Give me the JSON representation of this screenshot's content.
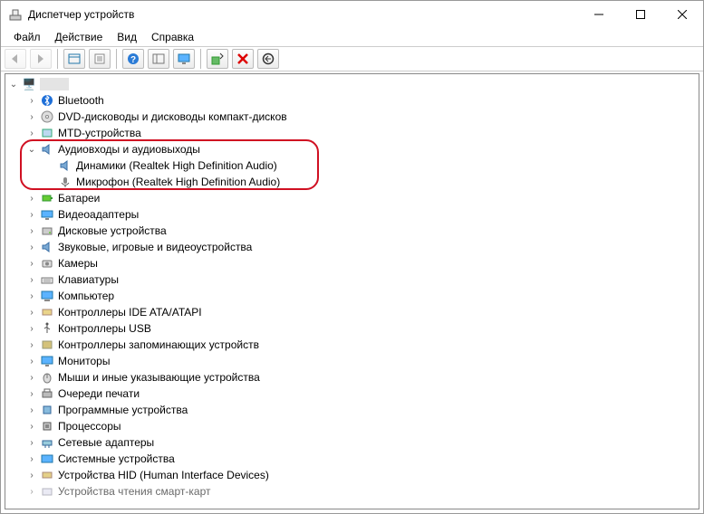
{
  "window": {
    "title": "Диспетчер устройств"
  },
  "menu": {
    "file": "Файл",
    "action": "Действие",
    "view": "Вид",
    "help": "Справка"
  },
  "tree": {
    "root": " ",
    "bluetooth": "Bluetooth",
    "dvd": "DVD-дисководы и дисководы компакт-дисков",
    "mtd": "MTD-устройства",
    "audio_io": "Аудиовходы и аудиовыходы",
    "speakers": "Динамики (Realtek High Definition Audio)",
    "microphone": "Микрофон (Realtek High Definition Audio)",
    "batteries": "Батареи",
    "video_adapters": "Видеоадаптеры",
    "disk_devices": "Дисковые устройства",
    "sound_game_video": "Звуковые, игровые и видеоустройства",
    "cameras": "Камеры",
    "keyboards": "Клавиатуры",
    "computer": "Компьютер",
    "ide_ata": "Контроллеры IDE ATA/ATAPI",
    "usb_ctrl": "Контроллеры USB",
    "storage_ctrl": "Контроллеры запоминающих устройств",
    "monitors": "Мониторы",
    "mice": "Мыши и иные указывающие устройства",
    "print_queues": "Очереди печати",
    "software_dev": "Программные устройства",
    "processors": "Процессоры",
    "net_adapters": "Сетевые адаптеры",
    "system_dev": "Системные устройства",
    "hid": "Устройства HID (Human Interface Devices)",
    "smartcard": "Устройства чтения смарт-карт"
  }
}
